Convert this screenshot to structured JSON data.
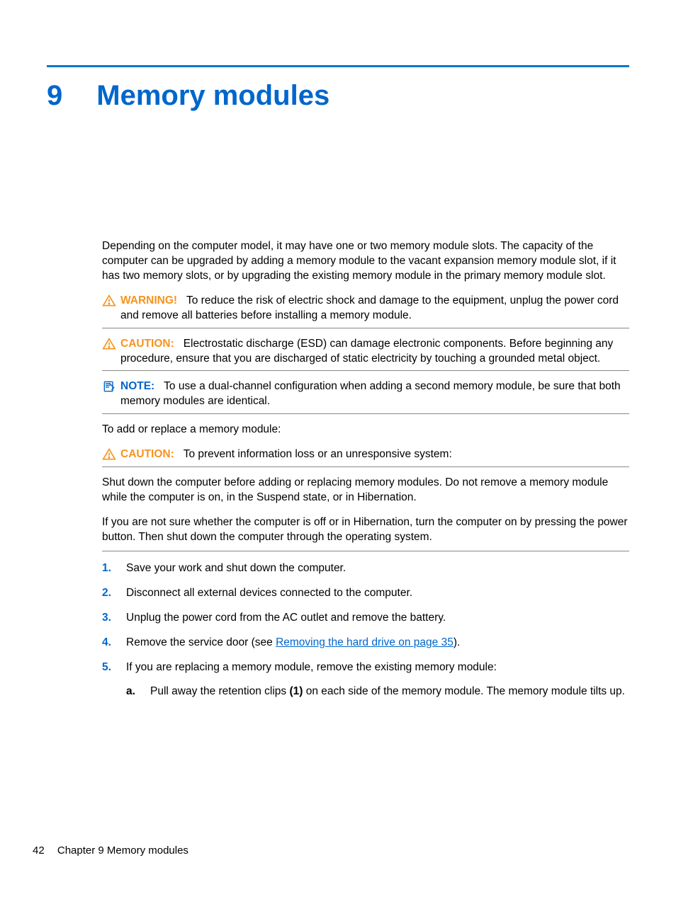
{
  "chapter": {
    "number": "9",
    "title": "Memory modules"
  },
  "intro": "Depending on the computer model, it may have one or two memory module slots. The capacity of the computer can be upgraded by adding a memory module to the vacant expansion memory module slot, if it has two memory slots, or by upgrading the existing memory module in the primary memory module slot.",
  "warning": {
    "label": "WARNING!",
    "text": "To reduce the risk of electric shock and damage to the equipment, unplug the power cord and remove all batteries before installing a memory module."
  },
  "caution1": {
    "label": "CAUTION:",
    "text": "Electrostatic discharge (ESD) can damage electronic components. Before beginning any procedure, ensure that you are discharged of static electricity by touching a grounded metal object."
  },
  "note": {
    "label": "NOTE:",
    "text": "To use a dual-channel configuration when adding a second memory module, be sure that both memory modules are identical."
  },
  "para_add": "To add or replace a memory module:",
  "caution2": {
    "label": "CAUTION:",
    "text": "To prevent information loss or an unresponsive system:"
  },
  "para_shutdown": "Shut down the computer before adding or replacing memory modules. Do not remove a memory module while the computer is on, in the Suspend state, or in Hibernation.",
  "para_unsure": "If you are not sure whether the computer is off or in Hibernation, turn the computer on by pressing the power button. Then shut down the computer through the operating system.",
  "steps": {
    "s1": {
      "num": "1.",
      "text": "Save your work and shut down the computer."
    },
    "s2": {
      "num": "2.",
      "text": "Disconnect all external devices connected to the computer."
    },
    "s3": {
      "num": "3.",
      "text": "Unplug the power cord from the AC outlet and remove the battery."
    },
    "s4": {
      "num": "4.",
      "pre": "Remove the service door (see ",
      "link": "Removing the hard drive on page 35",
      "post": ")."
    },
    "s5": {
      "num": "5.",
      "text": "If you are replacing a memory module, remove the existing memory module:",
      "a": {
        "num": "a.",
        "pre": "Pull away the retention clips ",
        "bold": "(1)",
        "post": " on each side of the memory module. The memory module tilts up."
      }
    }
  },
  "footer": {
    "page": "42",
    "chapter": "Chapter 9   Memory modules"
  }
}
